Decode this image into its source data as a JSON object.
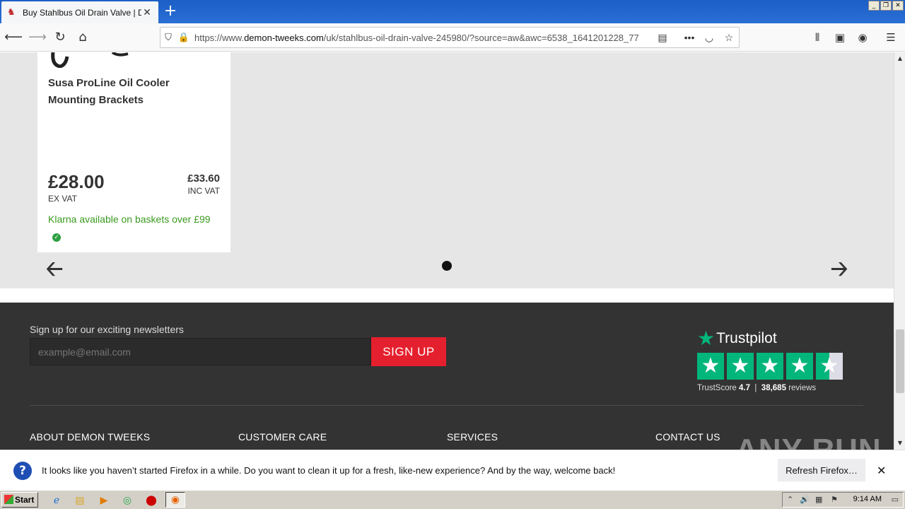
{
  "browser": {
    "tab_title": "Buy Stahlbus Oil Drain Valve | Demon",
    "url_prefix": "https://www.",
    "url_domain": "demon-tweeks.com",
    "url_path": "/uk/stahlbus-oil-drain-valve-245980/?source=aw&awc=6538_1641201228_77"
  },
  "product_card": {
    "name": "Susa ProLine Oil Cooler Mounting Brackets",
    "ex_vat_price": "£28.00",
    "ex_vat_label": "EX VAT",
    "inc_vat_price": "£33.60",
    "inc_vat_label": "INC VAT",
    "klarna_text": "Klarna available on baskets over £99"
  },
  "footer": {
    "newsletter_label": "Sign up for our exciting newsletters",
    "email_placeholder": "example@email.com",
    "signup_label": "SIGN UP",
    "trustpilot_brand": "Trustpilot",
    "trustscore_label": "TrustScore",
    "trustscore_value": "4.7",
    "reviews_count": "38,685",
    "reviews_label": "reviews",
    "rating_stars": 4.5,
    "columns": [
      "ABOUT DEMON TWEEKS",
      "CUSTOMER CARE",
      "SERVICES",
      "CONTACT US"
    ]
  },
  "notification": {
    "message": "It looks like you haven’t started Firefox in a while. Do you want to clean it up for a fresh, like-new experience? And by the way, welcome back!",
    "refresh_label": "Refresh Firefox…"
  },
  "watermark": "ANY RUN",
  "taskbar": {
    "start_label": "Start",
    "time": "9:14 AM"
  },
  "colors": {
    "accent_red": "#e5202e",
    "trustpilot_green": "#00b67a",
    "klarna_green": "#3a9a1f"
  }
}
